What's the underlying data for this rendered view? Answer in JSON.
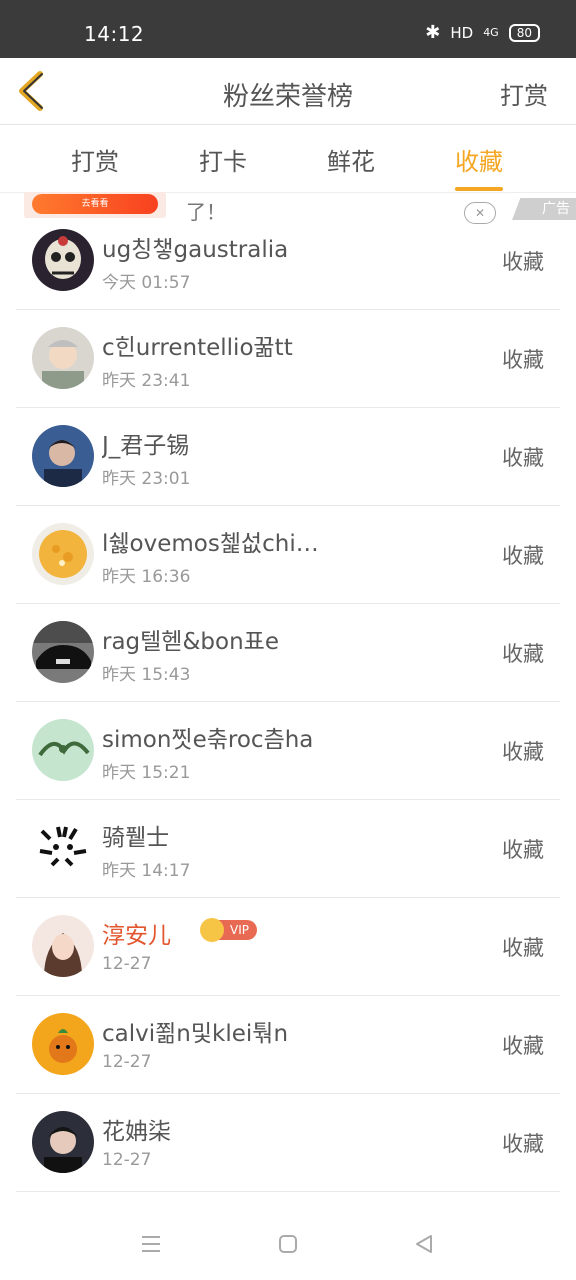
{
  "status_bar": {
    "time": "14:12",
    "network": "HD",
    "signal": "4G",
    "battery": "80"
  },
  "header": {
    "title": "粉丝荣誉榜",
    "action_label": "打赏"
  },
  "tabs": [
    {
      "label": "打赏",
      "active": false
    },
    {
      "label": "打卡",
      "active": false
    },
    {
      "label": "鲜花",
      "active": false
    },
    {
      "label": "收藏",
      "active": true
    }
  ],
  "ad": {
    "button_text": "去看看",
    "text": "了！",
    "close": "✕",
    "label": "广告"
  },
  "list": [
    {
      "name": "ug칭챟gaustralia",
      "time": "今天 01:57",
      "action": "收藏"
    },
    {
      "name": "c힌urrentellio꿂tt",
      "time": "昨天 23:41",
      "action": "收藏"
    },
    {
      "name": "J_君子锡",
      "time": "昨天 23:01",
      "action": "收藏"
    },
    {
      "name": "l쉟ovemos쳁섮chi…",
      "time": "昨天 16:36",
      "action": "收藏"
    },
    {
      "name": "rag텔헫&bon표e",
      "time": "昨天 15:43",
      "action": "收藏"
    },
    {
      "name": "simon찟e춖roc츰ha",
      "time": "昨天 15:21",
      "action": "收藏"
    },
    {
      "name": "骑퓉士",
      "time": "昨天 14:17",
      "action": "收藏"
    },
    {
      "name": "淳安儿",
      "time": "12-27",
      "action": "收藏",
      "vip": "VIP"
    },
    {
      "name": "calvi쬚n및klei퉊n",
      "time": "12-27",
      "action": "收藏"
    },
    {
      "name": "花姌柒",
      "time": "12-27",
      "action": "收藏"
    }
  ],
  "colors": {
    "accent": "#f5a623",
    "vip_name": "#e2552d",
    "status_bar": "#3b3b3b"
  },
  "icons": {
    "back": "chevron-left-icon",
    "menu": "menu-icon",
    "home": "home-icon",
    "back_nav": "triangle-back-icon"
  }
}
